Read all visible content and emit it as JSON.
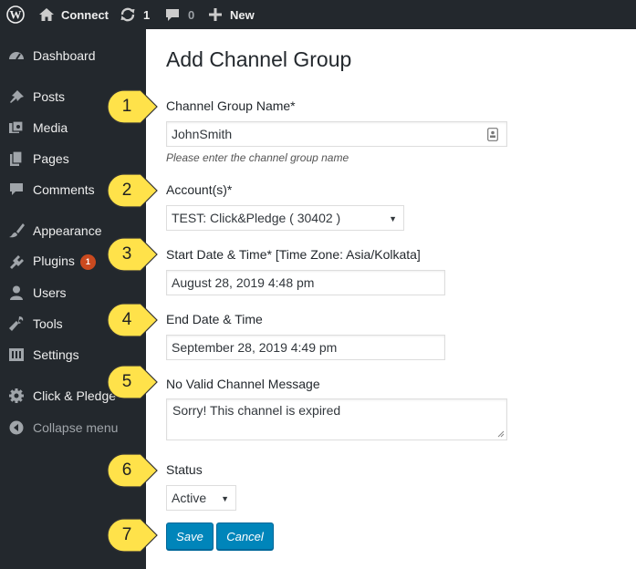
{
  "admin_bar": {
    "site_name": "Connect",
    "updates_count": "1",
    "comments_count": "0",
    "new_label": "New"
  },
  "sidebar": {
    "items": [
      {
        "label": "Dashboard",
        "icon": "dashboard-icon"
      },
      {
        "label": "Posts",
        "icon": "pin-icon"
      },
      {
        "label": "Media",
        "icon": "media-icon"
      },
      {
        "label": "Pages",
        "icon": "pages-icon"
      },
      {
        "label": "Comments",
        "icon": "comment-icon"
      },
      {
        "label": "Appearance",
        "icon": "brush-icon"
      },
      {
        "label": "Plugins",
        "icon": "plugin-icon",
        "badge": "1"
      },
      {
        "label": "Users",
        "icon": "user-icon"
      },
      {
        "label": "Tools",
        "icon": "wrench-icon"
      },
      {
        "label": "Settings",
        "icon": "settings-icon"
      },
      {
        "label": "Click & Pledge",
        "icon": "gear-icon"
      },
      {
        "label": "Collapse menu",
        "icon": "collapse-icon"
      }
    ]
  },
  "form": {
    "title": "Add Channel Group",
    "group_name_label": "Channel Group Name*",
    "group_name_value": "JohnSmith",
    "group_name_hint": "Please enter the channel group name",
    "account_label": "Account(s)*",
    "account_value": "TEST: Click&Pledge ( 30402 )",
    "start_label": "Start Date & Time* [Time Zone: Asia/Kolkata]",
    "start_value": "August 28, 2019 4:48 pm",
    "end_label": "End Date & Time",
    "end_value": "September 28, 2019 4:49 pm",
    "message_label": "No Valid Channel Message",
    "message_value": "Sorry! This channel is expired",
    "status_label": "Status",
    "status_value": "Active",
    "save_label": "Save",
    "cancel_label": "Cancel"
  },
  "callouts": [
    "1",
    "2",
    "3",
    "4",
    "5",
    "6",
    "7"
  ],
  "colors": {
    "admin_bg": "#23282d",
    "primary_button": "#0085ba",
    "callout_fill": "#ffe24a",
    "badge": "#ca4a1f"
  }
}
